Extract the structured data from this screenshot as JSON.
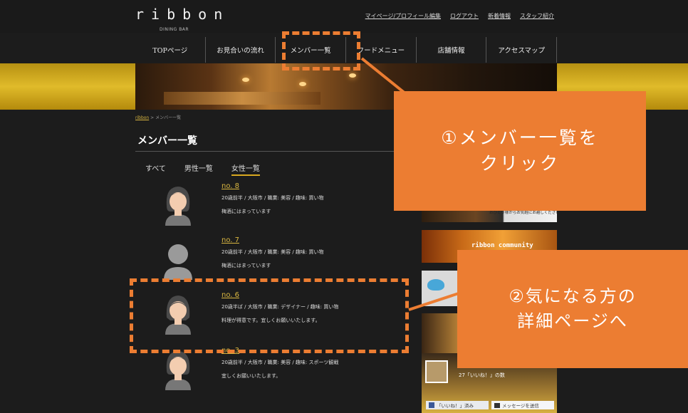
{
  "site": {
    "logo": "ribbon",
    "logo_sub": "DINING BAR",
    "top_links": [
      "マイページ/プロフィール編集",
      "ログアウト",
      "新着情報",
      "スタッフ紹介"
    ]
  },
  "nav": [
    "TOPページ",
    "お見合いの流れ",
    "メンバー一覧",
    "フードメニュー",
    "店舗情報",
    "アクセスマップ"
  ],
  "breadcrumb": {
    "home": "ribbon",
    "current": "> メンバー一覧"
  },
  "page_title": "メンバー一覧",
  "tabs": {
    "all": "すべて",
    "male": "男性一覧",
    "female": "女性一覧",
    "active": "female"
  },
  "members": [
    {
      "no": "no. 8",
      "info": "20歳前半 / 大阪市 / 職業: 美容 / 趣味: 買い物",
      "note": "梅酒にはまっています"
    },
    {
      "no": "no. 7",
      "info": "20歳前半 / 大阪市 / 職業: 美容 / 趣味: 買い物",
      "note": "梅酒にはまっています"
    },
    {
      "no": "no. 6",
      "info": "20歳半ば / 大阪市 / 職業: デザイナー / 趣味: 買い物",
      "note": "料理が得意です。宜しくお願いいたします。"
    },
    {
      "no": "no. 3",
      "info": "20歳前半 / 大阪市 / 職業: 美容 / 趣味: スポーツ観戦",
      "note": "宜しくお願いいたします。"
    }
  ],
  "sidebar": {
    "banner1_text": "おひとり様からお気軽にお越しください",
    "banner2_text": "ribbon community",
    "fb_page": "ri",
    "fb_likes": "27「いいね！」の数",
    "fb_like_button": "「いいね！」済み",
    "fb_message_button": "メッセージを送信"
  },
  "annotations": {
    "callout1_line1": "①メンバー一覧を",
    "callout1_line2": "クリック",
    "callout2_line1": "②気になる方の",
    "callout2_line2": "詳細ページへ"
  },
  "colors": {
    "accent": "#ec7d32",
    "link_gold": "#d9b640",
    "gold_band": "#e0bb2a",
    "background": "#1c1c1c"
  }
}
